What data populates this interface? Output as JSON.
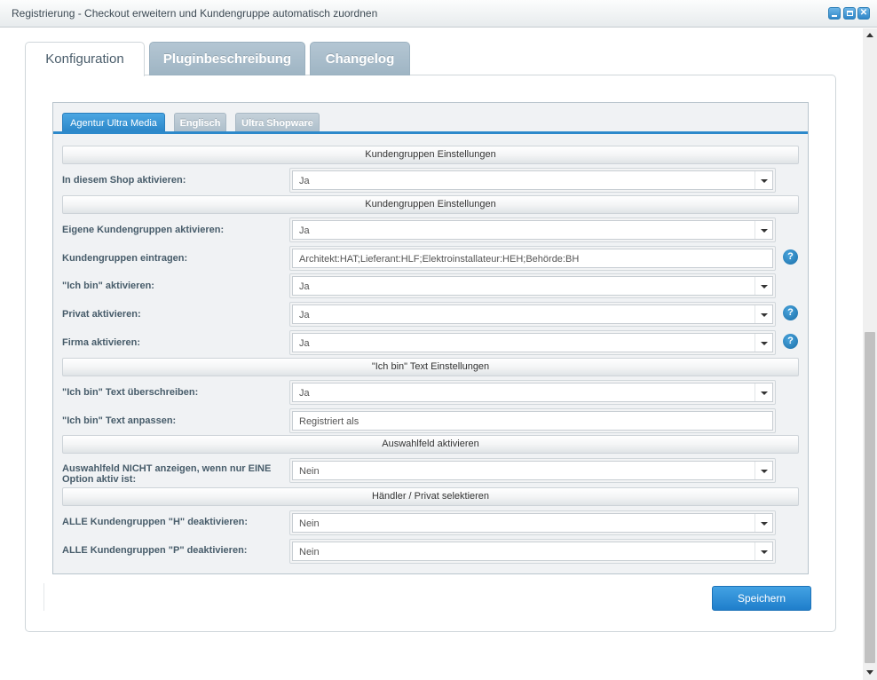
{
  "window": {
    "title": "Registrierung - Checkout erweitern und Kundengruppe automatisch zuordnen"
  },
  "main_tabs": [
    {
      "label": "Konfiguration",
      "active": true
    },
    {
      "label": "Pluginbeschreibung",
      "active": false
    },
    {
      "label": "Changelog",
      "active": false
    }
  ],
  "sub_tabs": [
    {
      "label": "Agentur Ultra Media",
      "active": true
    },
    {
      "label": "Englisch",
      "active": false
    },
    {
      "label": "Ultra Shopware",
      "active": false
    }
  ],
  "sections": [
    "Kundengruppen Einstellungen",
    "Kundengruppen Einstellungen",
    "\"Ich bin\" Text Einstellungen",
    "Auswahlfeld aktivieren",
    "Händler / Privat selektieren"
  ],
  "fields": {
    "shop_active": {
      "label": "In diesem Shop aktivieren:",
      "value": "Ja"
    },
    "own_groups": {
      "label": "Eigene Kundengruppen aktivieren:",
      "value": "Ja"
    },
    "groups_enter": {
      "label": "Kundengruppen eintragen:",
      "value": "Architekt:HAT;Lieferant:HLF;Elektroinstallateur:HEH;Behörde:BH"
    },
    "ich_bin_active": {
      "label": "\"Ich bin\" aktivieren:",
      "value": "Ja"
    },
    "privat_active": {
      "label": "Privat aktivieren:",
      "value": "Ja"
    },
    "firma_active": {
      "label": "Firma aktivieren:",
      "value": "Ja"
    },
    "ich_bin_override": {
      "label": "\"Ich bin\" Text überschreiben:",
      "value": "Ja"
    },
    "ich_bin_text": {
      "label": "\"Ich bin\" Text anpassen:",
      "value": "Registriert als"
    },
    "hide_single": {
      "label_line1": "Auswahlfeld NICHT anzeigen, wenn nur EINE",
      "label_line2": "Option aktiv ist:",
      "value": "Nein"
    },
    "deactivate_h": {
      "label": "ALLE Kundengruppen \"H\" deaktivieren:",
      "value": "Nein"
    },
    "deactivate_p": {
      "label": "ALLE Kundengruppen \"P\" deaktivieren:",
      "value": "Nein"
    }
  },
  "help_icon": "?",
  "save_label": "Speichern",
  "colors": {
    "accent": "#2d89cb",
    "tab_inactive": "#a9bdcb"
  }
}
